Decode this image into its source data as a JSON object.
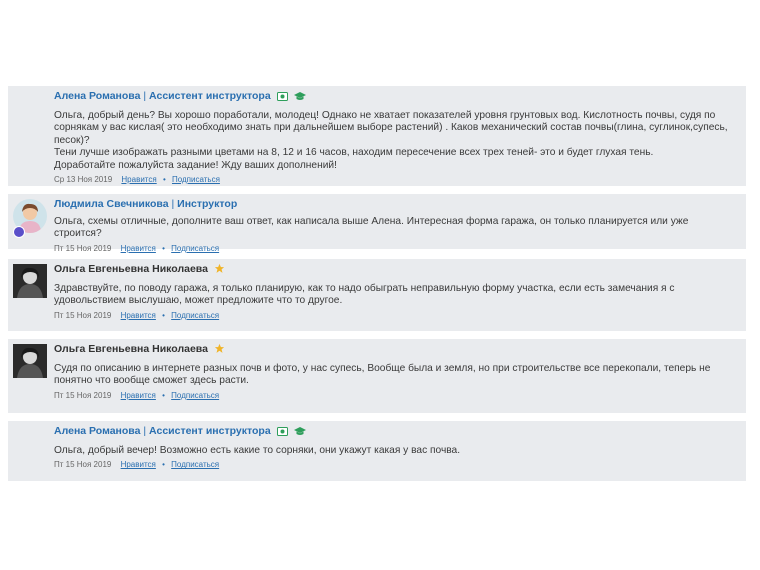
{
  "comments": [
    {
      "author": "Алена Романова",
      "role": "Ассистент инструктора",
      "paragraphs": [
        "Ольга, добрый день? Вы хорошо поработали, молодец! Однако не хватает показателей уровня грунтовых вод. Кислотность почвы, судя по сорнякам у вас кислая( это необходимо знать при дальнейшем выборе растений) . Каков механический состав почвы(глина, суглинок,супесь, песок)?",
        "Тени лучше изображать разными цветами на 8, 12 и 16 часов, находим пересечение всех трех теней- это и будет глухая тень.",
        "Доработайте пожалуйста задание! Жду ваших дополнений!"
      ],
      "date": "Ср 13 Ноя 2019",
      "like": "Нравится",
      "subscribe": "Подписаться"
    },
    {
      "author": "Людмила Свечникова",
      "role": "Инструктор",
      "paragraphs": [
        "Ольга, схемы отличные, дополните ваш ответ, как написала выше Алена. Интересная форма гаража, он только планируется или уже строится?"
      ],
      "date": "Пт 15 Ноя 2019",
      "like": "Нравится",
      "subscribe": "Подписаться"
    },
    {
      "author": "Ольга Евгеньевна Николаева",
      "paragraphs": [
        "Здравствуйте, по поводу гаража, я только планирую, как то надо обыграть неправильную форму участка, если есть замечания я с удовольствием выслушаю, может предложите что то другое."
      ],
      "date": "Пт 15 Ноя 2019",
      "like": "Нравится",
      "subscribe": "Подписаться"
    },
    {
      "author": "Ольга Евгеньевна Николаева",
      "paragraphs": [
        "Судя по описанию в интернете разных почв и фото, у нас супесь, Вообще была и земля, но при строительстве все перекопали, теперь не понятно что вообще сможет здесь расти."
      ],
      "date": "Пт 15 Ноя 2019",
      "like": "Нравится",
      "subscribe": "Подписаться"
    },
    {
      "author": "Алена Романова",
      "role": "Ассистент инструктора",
      "paragraphs": [
        "Ольга, добрый вечер! Возможно есть какие то сорняки, они укажут какая у вас почва."
      ],
      "date": "Пт 15 Ноя 2019",
      "like": "Нравится",
      "subscribe": "Подписаться"
    }
  ],
  "separator": "|",
  "dot": "•",
  "colors": {
    "link": "#2a6fb0",
    "card": "#e9ebee",
    "star": "#f0b429",
    "badge": "#2e9e5b"
  }
}
